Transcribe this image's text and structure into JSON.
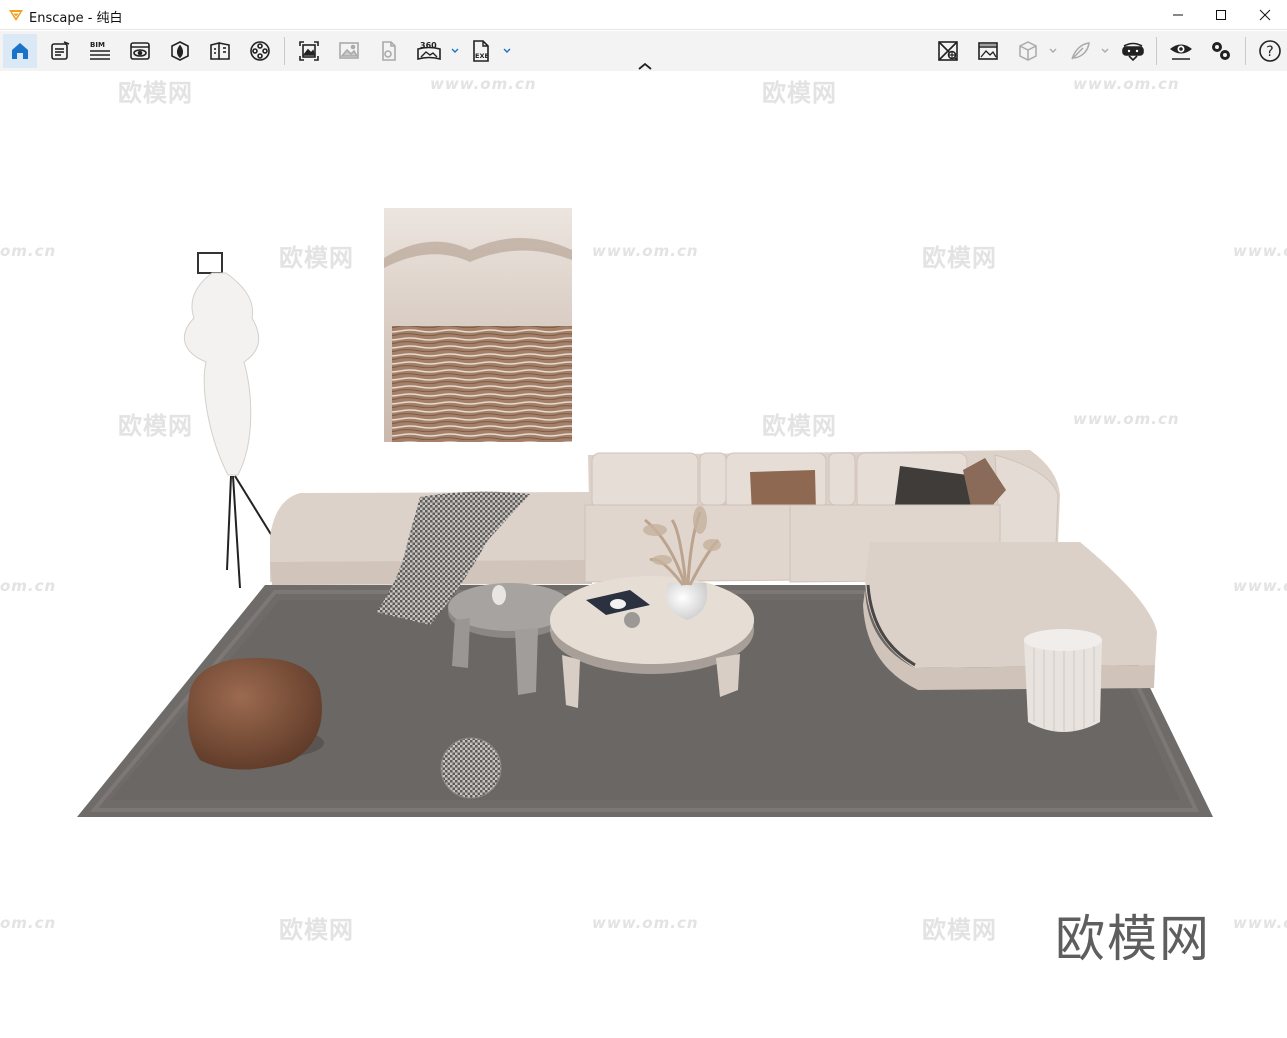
{
  "window": {
    "app_name": "Enscape",
    "title": "Enscape - 纯白",
    "controls": [
      "minimize",
      "maximize",
      "close"
    ]
  },
  "toolbar": {
    "left_icons": [
      "home-icon",
      "report-icon",
      "bim-icon",
      "view-icon",
      "asset-library-icon",
      "material-editor-icon",
      "video-editor-icon",
      "screenshot-icon",
      "batch-render-icon",
      "export-icon",
      "panorama-360-icon",
      "exe-export-icon"
    ],
    "bim_label": "BIM",
    "panorama_label": "360",
    "exe_label": "EXE",
    "right_icons": [
      "sketch-view-icon",
      "hatch-view-icon",
      "cube-icon",
      "feather-icon",
      "vr-headset-icon",
      "visual-settings-icon",
      "settings-icon",
      "help-icon"
    ],
    "help_label": "?"
  },
  "scene": {
    "watermark_cn": "欧模网",
    "watermark_url": "www.om.cn",
    "watermark_edge": "om.cn",
    "watermark_edge_right": "www.o",
    "logo_text": "欧模网"
  },
  "colors": {
    "accent": "#1a73c8",
    "logo_orange": "#f0a020",
    "rug": "#6f6b68",
    "sofa": "#ddd2ca"
  }
}
